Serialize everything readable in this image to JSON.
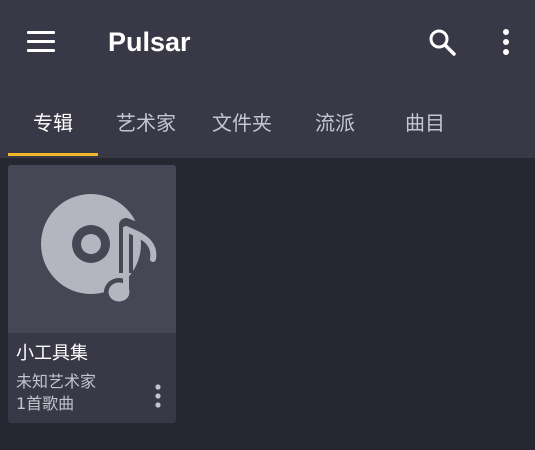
{
  "app": {
    "title": "Pulsar"
  },
  "toolbar": {
    "menu_icon": "hamburger-menu-icon",
    "search_icon": "search-icon",
    "more_icon": "more-vertical-icon"
  },
  "tabs": [
    {
      "label": "专辑",
      "active": true
    },
    {
      "label": "艺术家",
      "active": false
    },
    {
      "label": "文件夹",
      "active": false
    },
    {
      "label": "流派",
      "active": false
    },
    {
      "label": "曲目",
      "active": false
    }
  ],
  "albums": [
    {
      "title": "小工具集",
      "artist": "未知艺术家",
      "song_count": "1首歌曲",
      "artwork_icon": "album-placeholder-icon"
    }
  ],
  "colors": {
    "background": "#272731",
    "appbar": "#383846",
    "card": "#383846",
    "artwork_bg": "#464655",
    "artwork_icon": "#b5b5bf",
    "tab_indicator": "#f0b72b",
    "text_primary": "#ffffff",
    "text_secondary": "#c4c4cc"
  }
}
